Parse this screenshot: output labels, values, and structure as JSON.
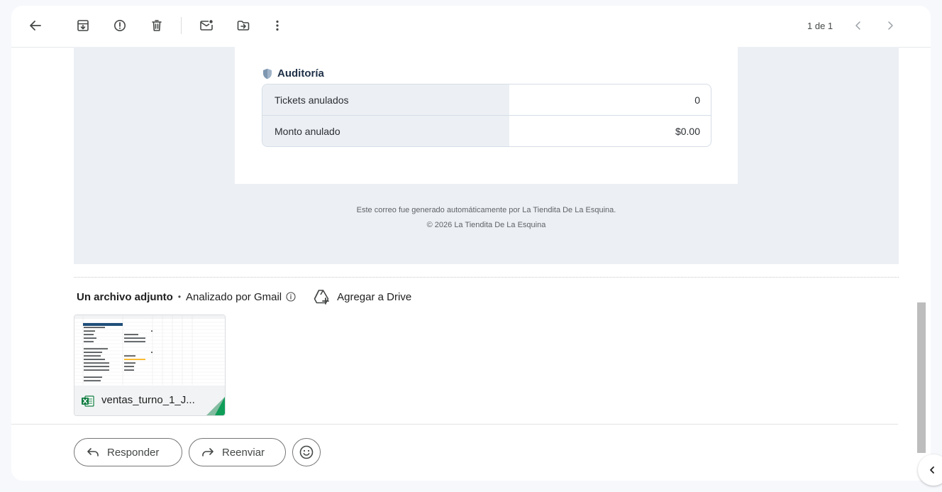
{
  "toolbar": {
    "page_count": "1 de 1",
    "icons": [
      "back-arrow-icon",
      "archive-icon",
      "report-spam-icon",
      "delete-icon",
      "mark-unread-icon",
      "move-to-icon",
      "more-vert-icon",
      "chevron-left-icon",
      "chevron-right-icon"
    ]
  },
  "email": {
    "section_title": "Auditoría",
    "section_icon": "shield-icon",
    "audit_rows": [
      {
        "label": "Tickets anulados",
        "value": "0"
      },
      {
        "label": "Monto anulado",
        "value": "$0.00"
      }
    ],
    "footer_line1": "Este correo fue generado automáticamente por La Tiendita De La Esquina.",
    "footer_line2": "© 2026 La Tiendita De La Esquina"
  },
  "attachments": {
    "count_label": "Un archivo adjunto",
    "scan_label": "Analizado por Gmail",
    "drive_label": "Agregar a Drive",
    "file": {
      "name": "ventas_turno_1_J...",
      "icon": "excel-icon",
      "preview_title": "CUENTA DE CIERRE DE TURNO"
    }
  },
  "actions": {
    "reply_label": "Responder",
    "forward_label": "Reenviar",
    "emoji_icon": "emoji-icon"
  },
  "colors": {
    "email_bg": "#ecf0f4",
    "heading": "#1e3047",
    "excel_green": "#107c41",
    "drive_corner": "#0f9d58"
  }
}
